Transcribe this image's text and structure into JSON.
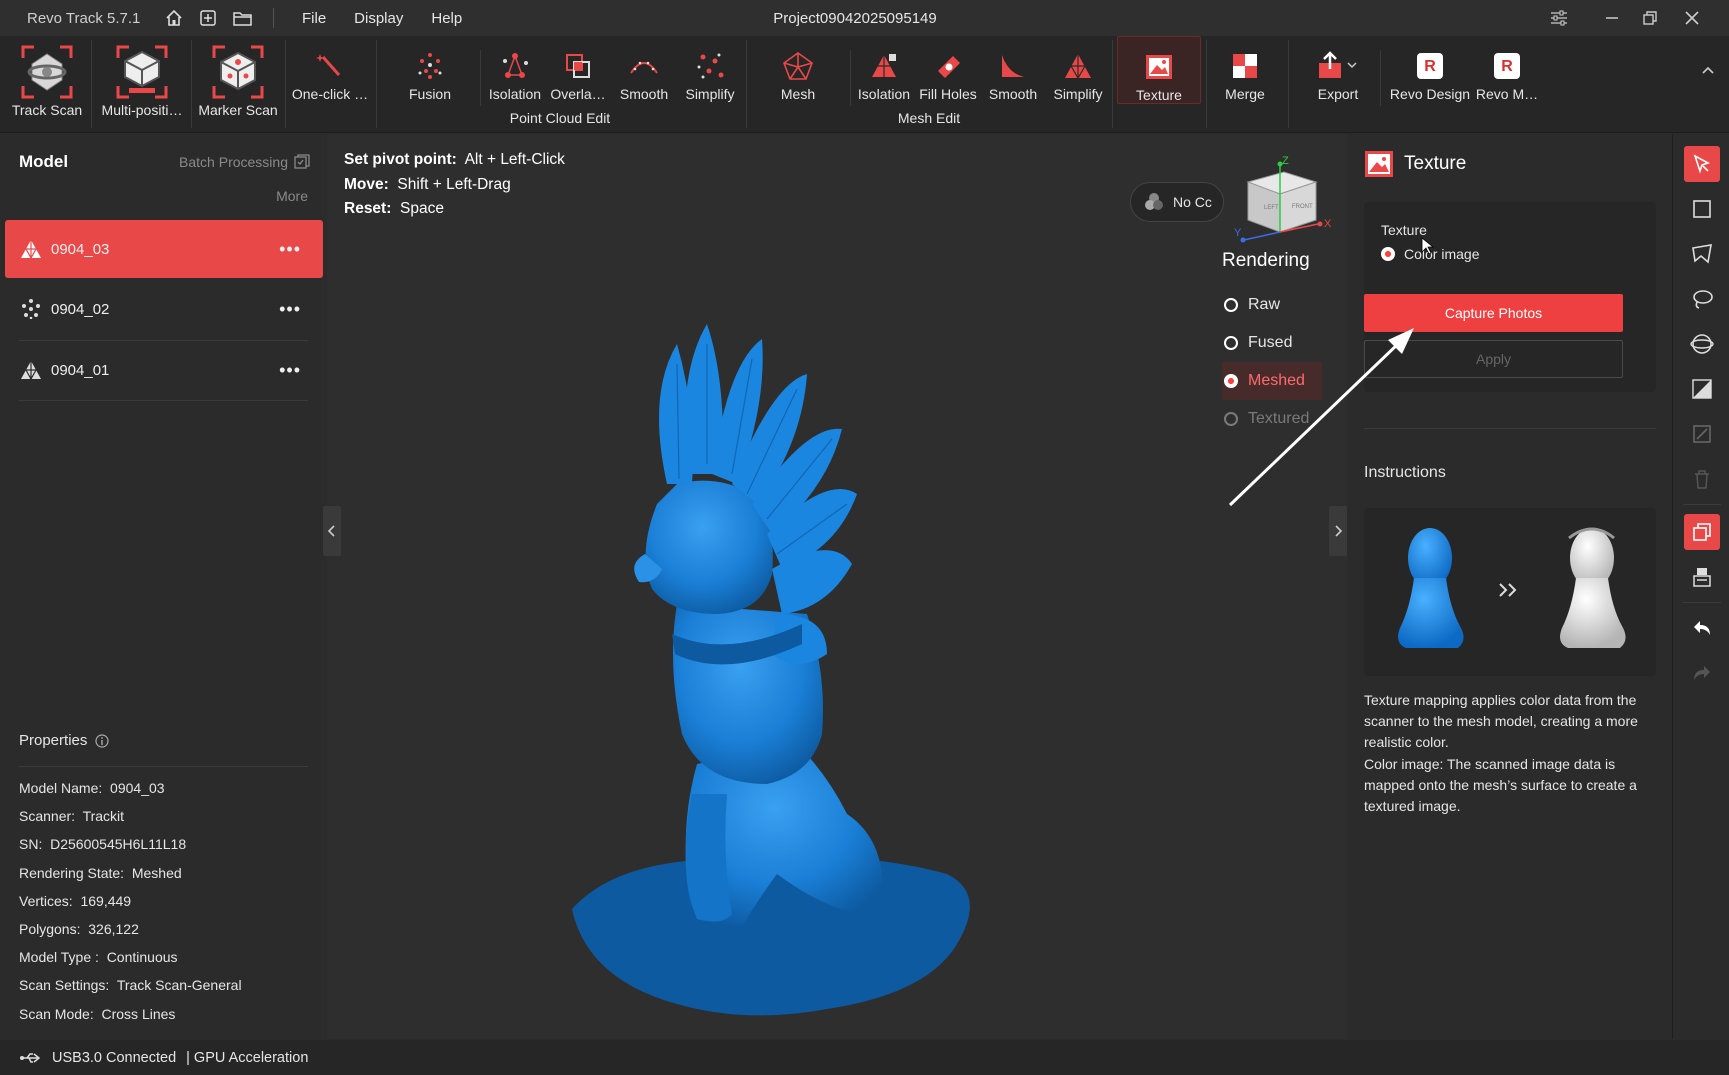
{
  "titlebar": {
    "app_name": "Revo Track 5.7.1",
    "menus": [
      "File",
      "Display",
      "Help"
    ],
    "project": "Project09042025095149"
  },
  "toolbar": {
    "scan_tools": [
      {
        "label": "Track Scan",
        "icon": "track-scan-icon"
      },
      {
        "label": "Multi-positi…",
        "icon": "multi-position-icon"
      },
      {
        "label": "Marker Scan",
        "icon": "marker-scan-icon"
      }
    ],
    "one_click": "One-click …",
    "point_cloud": {
      "items": [
        "Fusion",
        "Isolation",
        "Overla…",
        "Smooth",
        "Simplify"
      ],
      "group": "Point Cloud Edit"
    },
    "mesh_edit": {
      "items": [
        "Mesh",
        "Isolation",
        "Fill Holes",
        "Smooth",
        "Simplify"
      ],
      "group": "Mesh Edit"
    },
    "texture": "Texture",
    "merge": "Merge",
    "export": "Export",
    "revo_design": "Revo Design",
    "revo_measure": "Revo M…"
  },
  "left_panel": {
    "title": "Model",
    "batch": "Batch Processing",
    "more": "More",
    "models": [
      {
        "name": "0904_03",
        "type": "mesh",
        "selected": true
      },
      {
        "name": "0904_02",
        "type": "point-cloud",
        "selected": false
      },
      {
        "name": "0904_01",
        "type": "mesh",
        "selected": false
      }
    ],
    "properties_title": "Properties",
    "properties": [
      {
        "k": "Model Name:",
        "v": "0904_03"
      },
      {
        "k": "Scanner:",
        "v": "Trackit"
      },
      {
        "k": "SN:",
        "v": "D25600545H6L11L18"
      },
      {
        "k": "Rendering State:",
        "v": "Meshed"
      },
      {
        "k": "Vertices:",
        "v": "169,449"
      },
      {
        "k": "Polygons:",
        "v": "326,122"
      },
      {
        "k": "Model Type :",
        "v": "Continuous"
      },
      {
        "k": "Scan Settings:",
        "v": "Track Scan-General"
      },
      {
        "k": "Scan Mode:",
        "v": "Cross Lines"
      }
    ]
  },
  "viewport": {
    "hints": [
      {
        "k": "Set pivot point:",
        "v": "Alt + Left-Click"
      },
      {
        "k": "Move:",
        "v": "Shift + Left-Drag"
      },
      {
        "k": "Reset:",
        "v": "Space"
      }
    ],
    "no_color": "No Cc",
    "rendering_title": "Rendering",
    "rendering_options": [
      {
        "label": "Raw",
        "state": "normal"
      },
      {
        "label": "Fused",
        "state": "normal"
      },
      {
        "label": "Meshed",
        "state": "selected"
      },
      {
        "label": "Textured",
        "state": "disabled"
      }
    ],
    "cube_faces": {
      "left": "LEFT",
      "front": "FRONT"
    },
    "axes": {
      "z": "Z",
      "y": "Y",
      "x": "X"
    }
  },
  "right_panel": {
    "title": "Texture",
    "texture_label": "Texture",
    "radio_label": "Color image",
    "capture_button": "Capture Photos",
    "apply_button": "Apply",
    "instructions_title": "Instructions",
    "instructions_text_1": "Texture mapping applies color data from the scanner to the mesh model, creating a more realistic color.",
    "instructions_text_2": "Color image: The scanned image data is mapped onto the mesh’s surface to create a textured image."
  },
  "status": {
    "usb": "USB3.0 Connected",
    "gpu": "| GPU Acceleration"
  },
  "colors": {
    "accent": "#e84848",
    "model_blue": "#1a7fd6",
    "panel": "#2b2b2b",
    "viewport": "#2e2e2e"
  }
}
